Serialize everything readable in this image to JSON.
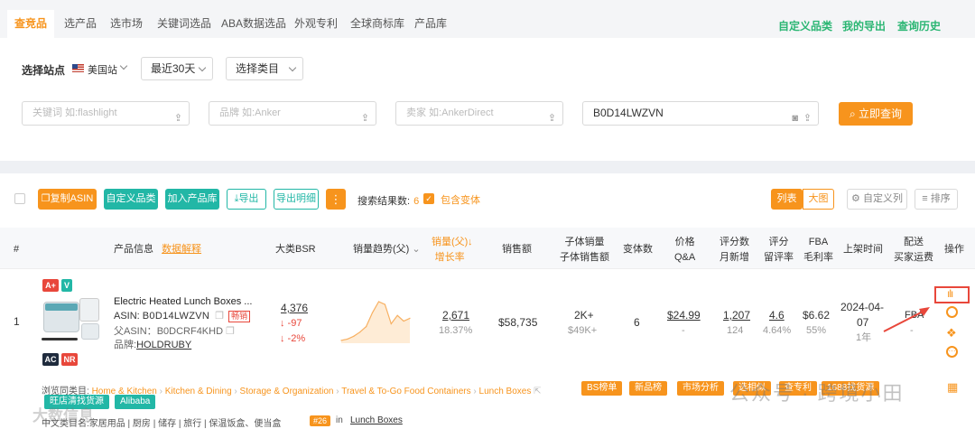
{
  "tabs": [
    "查竞品",
    "选产品",
    "选市场",
    "关键词选品",
    "ABA数据选品",
    "外观专利",
    "全球商标库",
    "产品库"
  ],
  "top_links": [
    "自定义品类",
    "我的导出",
    "查询历史"
  ],
  "filters": {
    "site_label": "选择站点",
    "site_value": "美国站",
    "period": "最近30天",
    "category": "选择类目"
  },
  "search": {
    "keyword_placeholder": "关键词 如:flashlight",
    "brand_placeholder": "品牌 如:Anker",
    "seller_placeholder": "卖家 如:AnkerDirect",
    "asin_value": "B0D14LWZVN",
    "submit": "立即查询"
  },
  "toolbar": {
    "copy_asin": "复制ASIN",
    "custom_category": "自定义品类",
    "add_library": "加入产品库",
    "export": "导出",
    "export_detail": "导出明细",
    "more": "⋮",
    "result_label": "搜索结果数:",
    "result_count": "6",
    "include_variants": "包含变体",
    "view_list": "列表",
    "view_grid": "大图",
    "custom_columns": "自定义列",
    "sort": "排序"
  },
  "columns": {
    "index": "#",
    "info": "产品信息",
    "info_link": "数据解释",
    "bsr": "大类BSR",
    "trend": "销量趋势(父)",
    "sales_line1": "销量(父)",
    "sales_line2": "增长率",
    "revenue": "销售额",
    "sub_sales_line1": "子体销量",
    "sub_sales_line2": "子体销售额",
    "variants": "变体数",
    "price_line1": "价格",
    "price_line2": "Q&A",
    "ratings_line1": "评分数",
    "ratings_line2": "月新增",
    "score_line1": "评分",
    "score_line2": "留评率",
    "fba_line1": "FBA",
    "fba_line2": "毛利率",
    "launch": "上架时间",
    "ship_line1": "配送",
    "ship_line2": "买家运费",
    "actions": "操作"
  },
  "row": {
    "index": "1",
    "badges_top": [
      "A+",
      "V"
    ],
    "badges_bottom": [
      "AC",
      "NR"
    ],
    "title": "Electric Heated Lunch Boxes ...",
    "asin_label": "ASIN:",
    "asin": "B0D14LWZVN",
    "hot_tag": "畅销",
    "parent_label": "父ASIN：",
    "parent_asin": "B0DCRF4KHD",
    "brand_label": "品牌:",
    "brand": "HOLDRUBY",
    "bsr": "4,376",
    "bsr_change": "↓ -97",
    "bsr_pct": "↓ -2%",
    "sales": "2,671",
    "growth": "18.37%",
    "revenue": "$58,735",
    "sub_sales": "2K+",
    "sub_revenue": "$49K+",
    "variants": "6",
    "price": "$24.99",
    "qa": "-",
    "ratings": "1,207",
    "ratings_new": "124",
    "score": "4.6",
    "review_rate": "4.64%",
    "fba": "$6.62",
    "margin": "55%",
    "launch_date_1": "2024-04-",
    "launch_date_2": "07",
    "launch_age": "1年",
    "shipping": "FBA",
    "shipping_fee": "-"
  },
  "browse": {
    "label": "浏览同类目:",
    "path": [
      "Home & Kitchen",
      "Kitchen & Dining",
      "Storage & Organization",
      "Travel & To-Go Food Containers",
      "Lunch Boxes"
    ],
    "chips": [
      "BS榜单",
      "新品榜",
      "市场分析",
      "选相似",
      "查专利",
      "1688找货源"
    ],
    "chips2": [
      "旺店清找货源",
      "Alibaba"
    ],
    "cn_label": "中文类目名:",
    "cn_path": "家居用品 | 厨房 | 储存 | 旅行 | 保温饭盒、便当盒",
    "rank": "#26",
    "rank_in": "in",
    "rank_cat": "Lunch Boxes"
  },
  "watermark": {
    "left": "大数信息",
    "right": "公众号 · 跨境小田"
  },
  "chart_data": {
    "type": "area",
    "title": "",
    "values": [
      2,
      3,
      5,
      8,
      12,
      22,
      30,
      28,
      14,
      20,
      16,
      18
    ]
  },
  "colors": {
    "accent": "#f7941d",
    "green": "#22b7a6",
    "red": "#e8473b"
  }
}
